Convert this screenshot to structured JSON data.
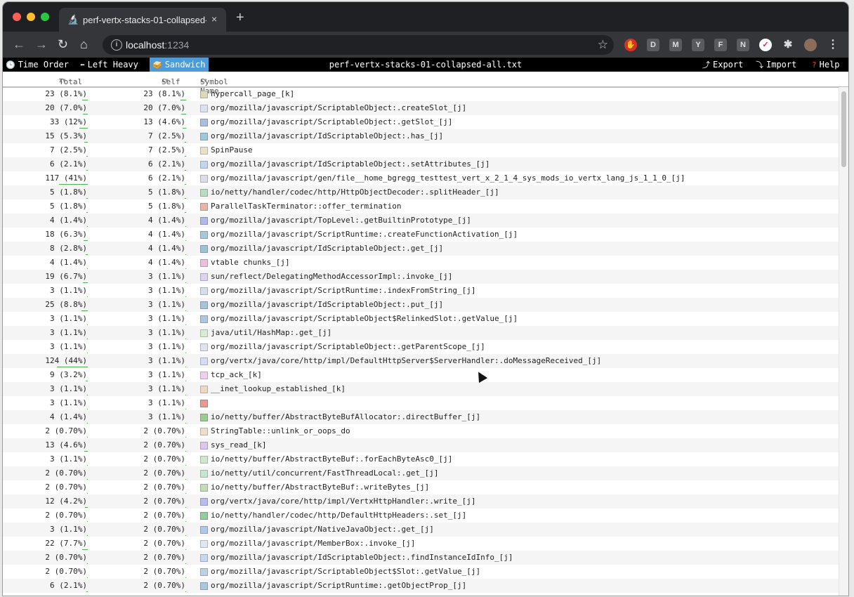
{
  "browser": {
    "tab_title": "perf-vertx-stacks-01-collapsed-all.txt",
    "tab_close": "×",
    "new_tab": "+",
    "url_host": "localhost",
    "url_port": ":1234",
    "extensions": [
      "record-icon",
      "D",
      "M",
      "Y",
      "F",
      "N",
      "pocket-icon",
      "puzzle-icon",
      "avatar",
      "menu-icon"
    ]
  },
  "speedscope": {
    "views": [
      {
        "label": "Time Order",
        "icon": "clock-icon"
      },
      {
        "label": "Left Heavy",
        "icon": "left-arrow-icon"
      },
      {
        "label": "Sandwich",
        "icon": "sandwich-icon",
        "active": true
      }
    ],
    "title": "perf-vertx-stacks-01-collapsed-all.txt",
    "export_label": "Export",
    "import_label": "Import",
    "help_label": "Help",
    "accent": "#4d9bd9"
  },
  "table": {
    "headers": {
      "total": "Total",
      "self": "Self",
      "symbol": "Symbol Name"
    },
    "rows": [
      {
        "total": "23 (8.1%)",
        "total_pct": 8.1,
        "self": "23 (8.1%)",
        "self_pct": 8.1,
        "symbol": "hypercall_page_[k]",
        "color": "#dcd9b8"
      },
      {
        "total": "20 (7.0%)",
        "total_pct": 7.0,
        "self": "20 (7.0%)",
        "self_pct": 7.0,
        "symbol": "org/mozilla/javascript/ScriptableObject:.createSlot_[j]",
        "color": "#dde0ee"
      },
      {
        "total": "33 (12%)",
        "total_pct": 12,
        "self": "13 (4.6%)",
        "self_pct": 4.6,
        "symbol": "org/mozilla/javascript/ScriptableObject:.getSlot_[j]",
        "color": "#a9bfe0"
      },
      {
        "total": "15 (5.3%)",
        "total_pct": 5.3,
        "self": "7 (2.5%)",
        "self_pct": 2.5,
        "symbol": "org/mozilla/javascript/IdScriptableObject:.has_[j]",
        "color": "#9fc8d9"
      },
      {
        "total": "7 (2.5%)",
        "total_pct": 2.5,
        "self": "7 (2.5%)",
        "self_pct": 2.5,
        "symbol": "SpinPause",
        "color": "#ece0c8"
      },
      {
        "total": "6 (2.1%)",
        "total_pct": 2.1,
        "self": "6 (2.1%)",
        "self_pct": 2.1,
        "symbol": "org/mozilla/javascript/IdScriptableObject:.setAttributes_[j]",
        "color": "#c2d6ea"
      },
      {
        "total": "117 (41%)",
        "total_pct": 41,
        "self": "6 (2.1%)",
        "self_pct": 2.1,
        "symbol": "org/mozilla/javascript/gen/file__home_bgregg_testtest_vert_x_2_1_4_sys_mods_io_vertx_lang_js_1_1_0_[j]",
        "color": "#dcdcea"
      },
      {
        "total": "5 (1.8%)",
        "total_pct": 1.8,
        "self": "5 (1.8%)",
        "self_pct": 1.8,
        "symbol": "io/netty/handler/codec/http/HttpObjectDecoder:.splitHeader_[j]",
        "color": "#b7dcc0"
      },
      {
        "total": "5 (1.8%)",
        "total_pct": 1.8,
        "self": "5 (1.8%)",
        "self_pct": 1.8,
        "symbol": "ParallelTaskTerminator::offer_termination",
        "color": "#e8b4a8"
      },
      {
        "total": "4 (1.4%)",
        "total_pct": 1.4,
        "self": "4 (1.4%)",
        "self_pct": 1.4,
        "symbol": "org/mozilla/javascript/TopLevel:.getBuiltinPrototype_[j]",
        "color": "#b1b9e6"
      },
      {
        "total": "18 (6.3%)",
        "total_pct": 6.3,
        "self": "4 (1.4%)",
        "self_pct": 1.4,
        "symbol": "org/mozilla/javascript/ScriptRuntime:.createFunctionActivation_[j]",
        "color": "#a6c9dd"
      },
      {
        "total": "8 (2.8%)",
        "total_pct": 2.8,
        "self": "4 (1.4%)",
        "self_pct": 1.4,
        "symbol": "org/mozilla/javascript/IdScriptableObject:.get_[j]",
        "color": "#9dc3d8"
      },
      {
        "total": "4 (1.4%)",
        "total_pct": 1.4,
        "self": "4 (1.4%)",
        "self_pct": 1.4,
        "symbol": "vtable chunks_[j]",
        "color": "#ecc0dc"
      },
      {
        "total": "19 (6.7%)",
        "total_pct": 6.7,
        "self": "3 (1.1%)",
        "self_pct": 1.1,
        "symbol": "sun/reflect/DelegatingMethodAccessorImpl:.invoke_[j]",
        "color": "#dcd4ec"
      },
      {
        "total": "3 (1.1%)",
        "total_pct": 1.1,
        "self": "3 (1.1%)",
        "self_pct": 1.1,
        "symbol": "org/mozilla/javascript/ScriptRuntime:.indexFromString_[j]",
        "color": "#d4dcee"
      },
      {
        "total": "25 (8.8%)",
        "total_pct": 8.8,
        "self": "3 (1.1%)",
        "self_pct": 1.1,
        "symbol": "org/mozilla/javascript/IdScriptableObject:.put_[j]",
        "color": "#a4c4dc"
      },
      {
        "total": "3 (1.1%)",
        "total_pct": 1.1,
        "self": "3 (1.1%)",
        "self_pct": 1.1,
        "symbol": "org/mozilla/javascript/ScriptableObject$RelinkedSlot:.getValue_[j]",
        "color": "#aec6e4"
      },
      {
        "total": "3 (1.1%)",
        "total_pct": 1.1,
        "self": "3 (1.1%)",
        "self_pct": 1.1,
        "symbol": "java/util/HashMap:.get_[j]",
        "color": "#d8ecd4"
      },
      {
        "total": "3 (1.1%)",
        "total_pct": 1.1,
        "self": "3 (1.1%)",
        "self_pct": 1.1,
        "symbol": "org/mozilla/javascript/ScriptableObject:.getParentScope_[j]",
        "color": "#dde3f0"
      },
      {
        "total": "124 (44%)",
        "total_pct": 44,
        "self": "3 (1.1%)",
        "self_pct": 1.1,
        "symbol": "org/vertx/java/core/http/impl/DefaultHttpServer$ServerHandler:.doMessageReceived_[j]",
        "color": "#d6dcf2"
      },
      {
        "total": "9 (3.2%)",
        "total_pct": 3.2,
        "self": "3 (1.1%)",
        "self_pct": 1.1,
        "symbol": "tcp_ack_[k]",
        "color": "#eecff0"
      },
      {
        "total": "3 (1.1%)",
        "total_pct": 1.1,
        "self": "3 (1.1%)",
        "self_pct": 1.1,
        "symbol": "__inet_lookup_established_[k]",
        "color": "#ecd8c4"
      },
      {
        "total": "3 (1.1%)",
        "total_pct": 1.1,
        "self": "3 (1.1%)",
        "self_pct": 1.1,
        "symbol": "",
        "color": "#e89a90"
      },
      {
        "total": "4 (1.4%)",
        "total_pct": 1.4,
        "self": "3 (1.1%)",
        "self_pct": 1.1,
        "symbol": "io/netty/buffer/AbstractByteBufAllocator:.directBuffer_[j]",
        "color": "#9ccc94"
      },
      {
        "total": "2 (0.70%)",
        "total_pct": 0.7,
        "self": "2 (0.70%)",
        "self_pct": 0.7,
        "symbol": "StringTable::unlink_or_oops_do",
        "color": "#f0dcc8"
      },
      {
        "total": "13 (4.6%)",
        "total_pct": 4.6,
        "self": "2 (0.70%)",
        "self_pct": 0.7,
        "symbol": "sys_read_[k]",
        "color": "#dcc6ec"
      },
      {
        "total": "3 (1.1%)",
        "total_pct": 1.1,
        "self": "2 (0.70%)",
        "self_pct": 0.7,
        "symbol": "io/netty/buffer/AbstractByteBuf:.forEachByteAsc0_[j]",
        "color": "#cfe6cc"
      },
      {
        "total": "2 (0.70%)",
        "total_pct": 0.7,
        "self": "2 (0.70%)",
        "self_pct": 0.7,
        "symbol": "io/netty/util/concurrent/FastThreadLocal:.get_[j]",
        "color": "#c8e4d0"
      },
      {
        "total": "2 (0.70%)",
        "total_pct": 0.7,
        "self": "2 (0.70%)",
        "self_pct": 0.7,
        "symbol": "io/netty/buffer/AbstractByteBuf:.writeBytes_[j]",
        "color": "#c0ddb8"
      },
      {
        "total": "12 (4.2%)",
        "total_pct": 4.2,
        "self": "2 (0.70%)",
        "self_pct": 0.7,
        "symbol": "org/vertx/java/core/http/impl/VertxHttpHandler:.write_[j]",
        "color": "#b9bdee"
      },
      {
        "total": "2 (0.70%)",
        "total_pct": 0.7,
        "self": "2 (0.70%)",
        "self_pct": 0.7,
        "symbol": "io/netty/handler/codec/http/DefaultHttpHeaders:.set_[j]",
        "color": "#94cc9c"
      },
      {
        "total": "3 (1.1%)",
        "total_pct": 1.1,
        "self": "2 (0.70%)",
        "self_pct": 0.7,
        "symbol": "org/mozilla/javascript/NativeJavaObject:.get_[j]",
        "color": "#b0c8e8"
      },
      {
        "total": "22 (7.7%)",
        "total_pct": 7.7,
        "self": "2 (0.70%)",
        "self_pct": 0.7,
        "symbol": "org/mozilla/javascript/MemberBox:.invoke_[j]",
        "color": "#e0e6f2"
      },
      {
        "total": "2 (0.70%)",
        "total_pct": 0.7,
        "self": "2 (0.70%)",
        "self_pct": 0.7,
        "symbol": "org/mozilla/javascript/IdScriptableObject:.findInstanceIdInfo_[j]",
        "color": "#c6d8ee"
      },
      {
        "total": "2 (0.70%)",
        "total_pct": 0.7,
        "self": "2 (0.70%)",
        "self_pct": 0.7,
        "symbol": "org/mozilla/javascript/ScriptableObject$Slot:.getValue_[j]",
        "color": "#bcd0ea"
      },
      {
        "total": "6 (2.1%)",
        "total_pct": 2.1,
        "self": "2 (0.70%)",
        "self_pct": 0.7,
        "symbol": "org/mozilla/javascript/ScriptRuntime:.getObjectProp_[j]",
        "color": "#a8c8e2"
      }
    ]
  }
}
